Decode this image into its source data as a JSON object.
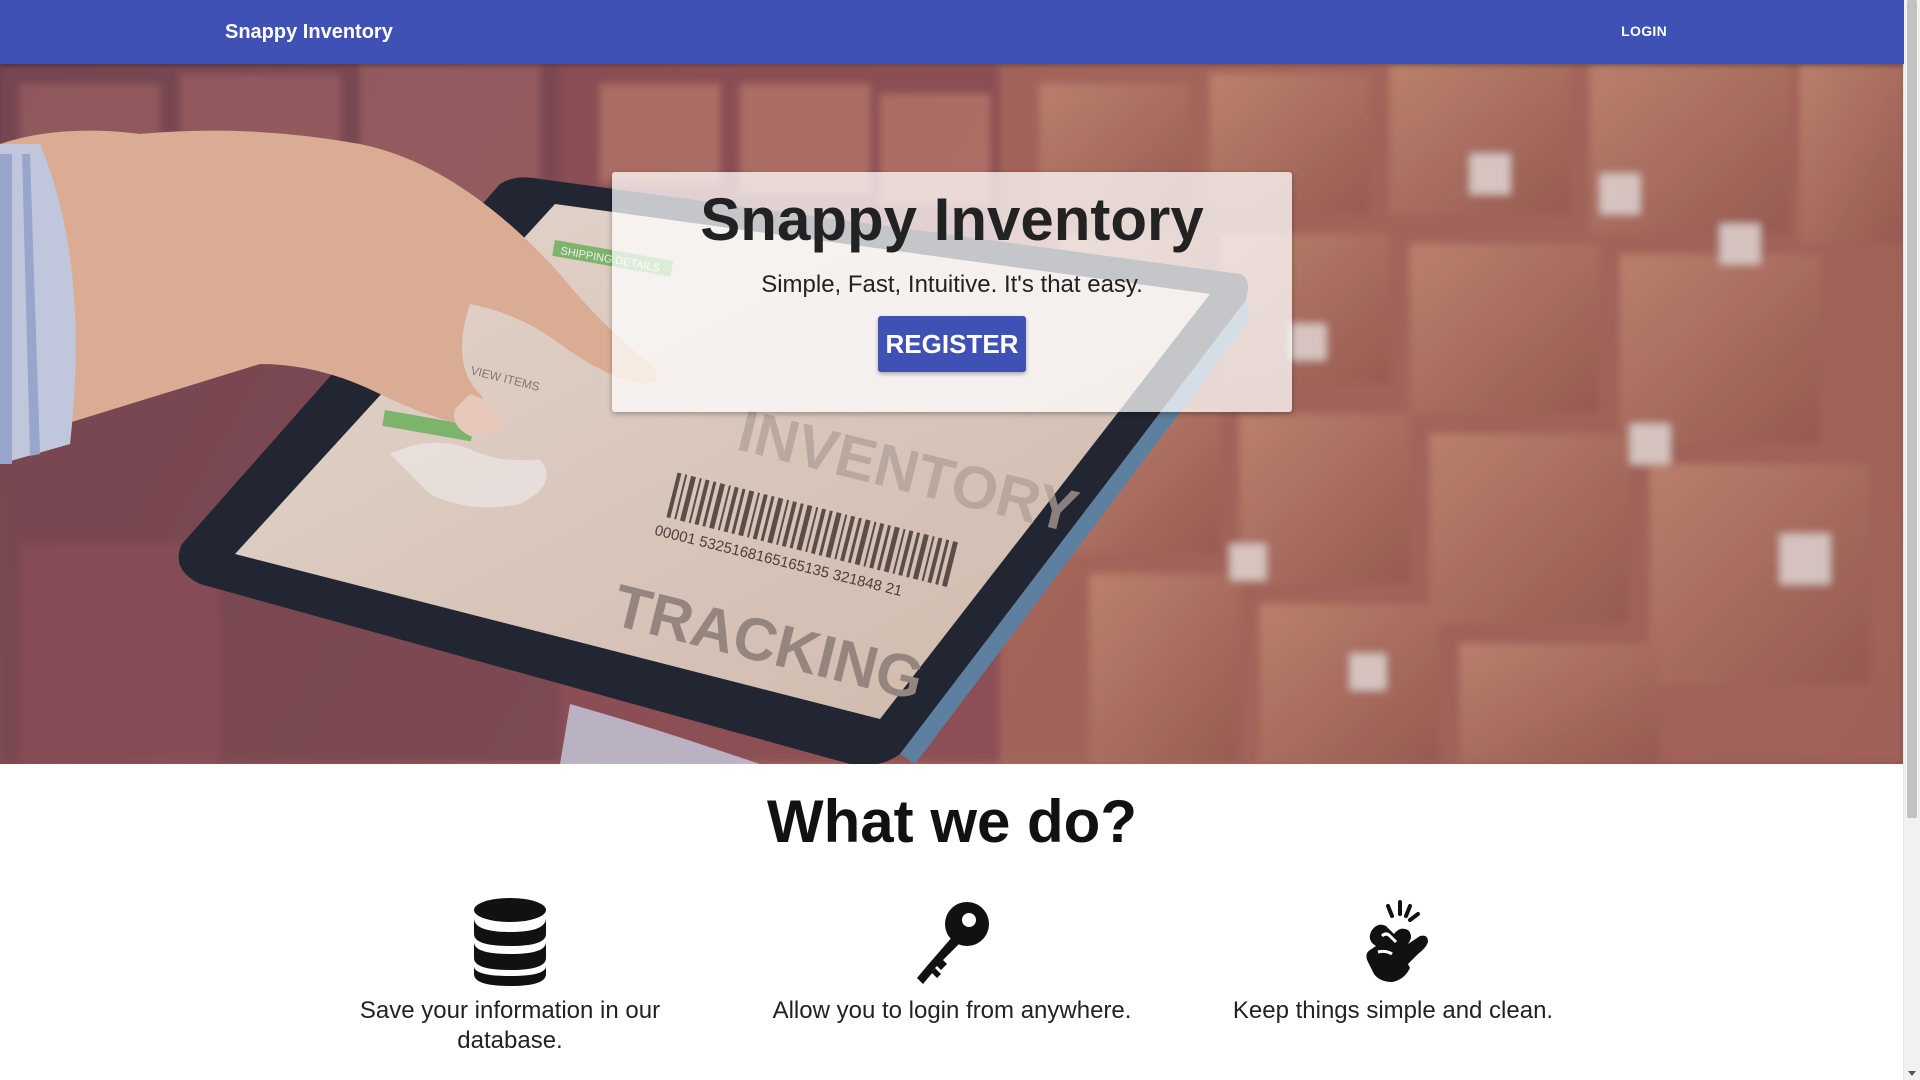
{
  "navbar": {
    "brand": "Snappy Inventory",
    "login_label": "LOGIN",
    "background_color": "#3f51b5"
  },
  "hero": {
    "title": "Snappy Inventory",
    "subtitle": "Simple, Fast, Intuitive. It's that easy.",
    "register_label": "REGISTER",
    "background_image": "warehouse-tablet-photo",
    "tablet_text": {
      "label_top": "SHIPPING DETAILS",
      "view_items": "VIEW ITEMS",
      "tracking_word": "TRACKING",
      "inventory_word": "INVENTORY",
      "barcode_number": "00001 5325168165165135 321848 21"
    }
  },
  "features": {
    "title": "What we do?",
    "items": [
      {
        "icon": "database-icon",
        "text": "Save your information in our database."
      },
      {
        "icon": "key-icon",
        "text": "Allow you to login from anywhere."
      },
      {
        "icon": "snap-fingers-icon",
        "text": "Keep things simple and clean."
      }
    ]
  }
}
